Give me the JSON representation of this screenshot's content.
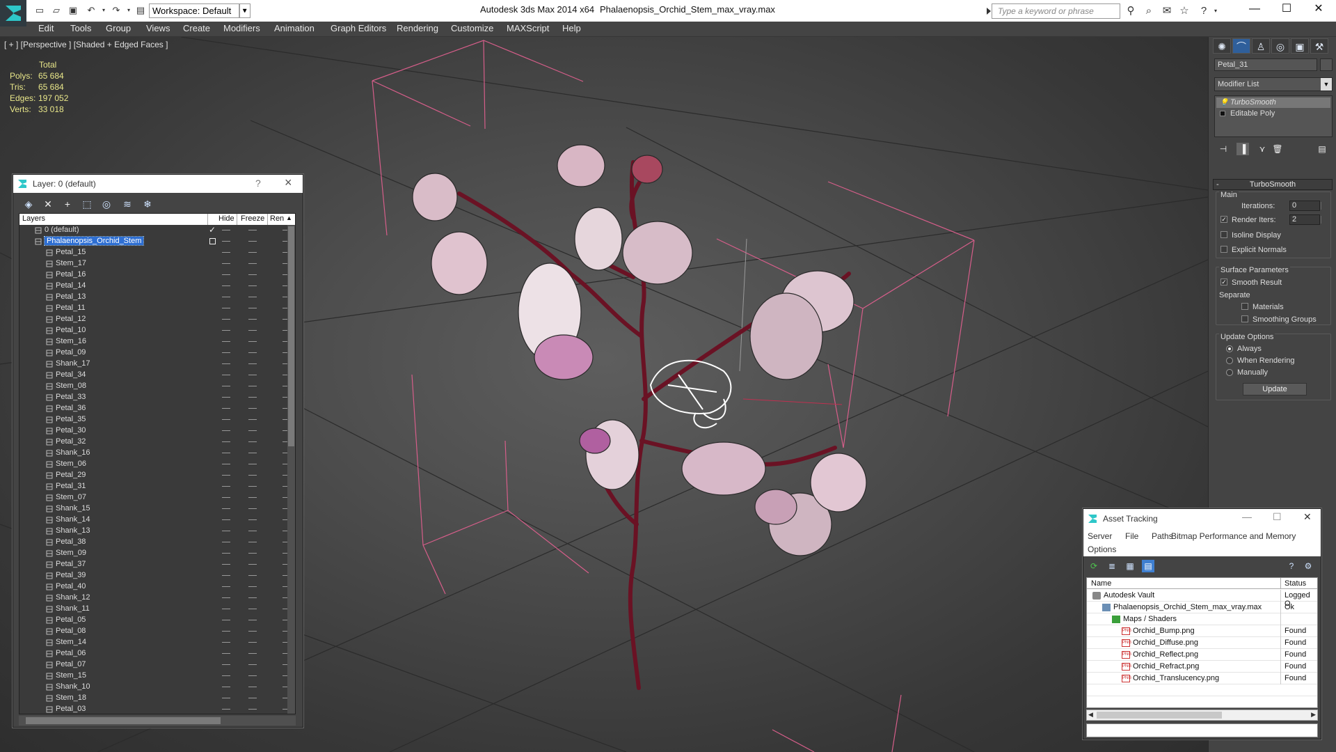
{
  "titlebar": {
    "workspace": "Workspace: Default",
    "app_title": "Autodesk 3ds Max  2014 x64",
    "file_title": "Phalaenopsis_Orchid_Stem_max_vray.max",
    "search_placeholder": "Type a keyword or phrase"
  },
  "menu": [
    "Edit",
    "Tools",
    "Group",
    "Views",
    "Create",
    "Modifiers",
    "Animation",
    "Graph Editors",
    "Rendering",
    "Customize",
    "MAXScript",
    "Help"
  ],
  "viewport": {
    "label": "[ + ] [Perspective ] [Shaded + Edged Faces ]",
    "stats": {
      "header": "Total",
      "rows": [
        {
          "k": "Polys:",
          "v": "65 684"
        },
        {
          "k": "Tris:",
          "v": "65 684"
        },
        {
          "k": "Edges:",
          "v": "197 052"
        },
        {
          "k": "Verts:",
          "v": "33 018"
        }
      ]
    },
    "colors": {
      "wire_box": "#e06a95",
      "stem": "#6e1426",
      "petal": "#e6cfd8",
      "selected": "#ffffff",
      "grid": "#2a2a2a"
    }
  },
  "layer_panel": {
    "title": "Layer: 0 (default)",
    "help": "?",
    "columns": {
      "layers": "Layers",
      "hide": "Hide",
      "freeze": "Freeze",
      "render": "Ren"
    },
    "default_layer": "0 (default)",
    "selected_layer": "Phalaenopsis_Orchid_Stem",
    "objects": [
      "Petal_15",
      "Stem_17",
      "Petal_16",
      "Petal_14",
      "Petal_13",
      "Petal_11",
      "Petal_12",
      "Petal_10",
      "Stem_16",
      "Petal_09",
      "Shank_17",
      "Petal_34",
      "Stem_08",
      "Petal_33",
      "Petal_36",
      "Petal_35",
      "Petal_30",
      "Petal_32",
      "Shank_16",
      "Stem_06",
      "Petal_29",
      "Petal_31",
      "Stem_07",
      "Shank_15",
      "Shank_14",
      "Shank_13",
      "Petal_38",
      "Stem_09",
      "Petal_37",
      "Petal_39",
      "Petal_40",
      "Shank_12",
      "Shank_11",
      "Petal_05",
      "Petal_08",
      "Stem_14",
      "Petal_06",
      "Petal_07",
      "Stem_15",
      "Shank_10",
      "Stem_18",
      "Petal_03"
    ]
  },
  "command_panel": {
    "object_name": "Petal_31",
    "modifier_list": "Modifier List",
    "stack": [
      "TurboSmooth",
      "Editable Poly"
    ],
    "rollout_title": "TurboSmooth",
    "main": {
      "group": "Main",
      "iterations_label": "Iterations:",
      "iterations": "0",
      "render_iters_label": "Render Iters:",
      "render_iters": "2",
      "isoline": "Isoline Display",
      "explicit": "Explicit Normals"
    },
    "surface": {
      "group": "Surface Parameters",
      "smooth_result": "Smooth Result",
      "separate": "Separate",
      "materials": "Materials",
      "smoothing_groups": "Smoothing Groups"
    },
    "update": {
      "group": "Update Options",
      "always": "Always",
      "when_rendering": "When Rendering",
      "manually": "Manually",
      "button": "Update"
    }
  },
  "asset_tracking": {
    "title": "Asset Tracking",
    "menu": [
      "Server",
      "File",
      "Paths",
      "Bitmap Performance and Memory",
      "Options"
    ],
    "columns": {
      "name": "Name",
      "status": "Status"
    },
    "rows": [
      {
        "name": "Autodesk Vault",
        "status": "Logged O",
        "level": 0,
        "icon": "vault"
      },
      {
        "name": "Phalaenopsis_Orchid_Stem_max_vray.max",
        "status": "Ok",
        "level": 1,
        "icon": "file"
      },
      {
        "name": "Maps / Shaders",
        "status": "",
        "level": 2,
        "icon": "maps"
      },
      {
        "name": "Orchid_Bump.png",
        "status": "Found",
        "level": 3,
        "icon": "png"
      },
      {
        "name": "Orchid_Diffuse.png",
        "status": "Found",
        "level": 3,
        "icon": "png"
      },
      {
        "name": "Orchid_Reflect.png",
        "status": "Found",
        "level": 3,
        "icon": "png"
      },
      {
        "name": "Orchid_Refract.png",
        "status": "Found",
        "level": 3,
        "icon": "png"
      },
      {
        "name": "Orchid_Translucency.png",
        "status": "Found",
        "level": 3,
        "icon": "png"
      }
    ]
  }
}
